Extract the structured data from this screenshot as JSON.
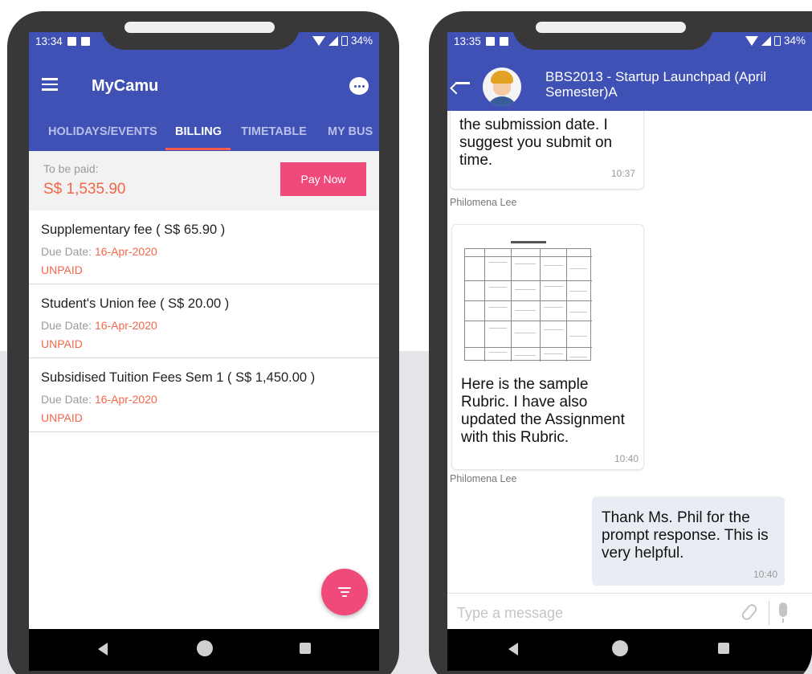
{
  "left_phone": {
    "status": {
      "time": "13:34",
      "battery": "34%"
    },
    "app_title": "MyCamu",
    "tabs": [
      "HOLIDAYS/EVENTS",
      "BILLING",
      "TIMETABLE",
      "MY BUS"
    ],
    "active_tab": "BILLING",
    "to_be_paid": {
      "label": "To be paid:",
      "amount": "S$ 1,535.90",
      "button": "Pay Now"
    },
    "fees": [
      {
        "title": "Supplementary fee ( S$ 65.90 )",
        "due_label": "Due Date: ",
        "due_date": "16-Apr-2020",
        "status": "UNPAID"
      },
      {
        "title": "Student's Union fee ( S$ 20.00 )",
        "due_label": "Due Date: ",
        "due_date": "16-Apr-2020",
        "status": "UNPAID"
      },
      {
        "title": "Subsidised Tuition Fees Sem 1 ( S$ 1,450.00 )",
        "due_label": "Due Date: ",
        "due_date": "16-Apr-2020",
        "status": "UNPAID"
      }
    ]
  },
  "right_phone": {
    "status": {
      "time": "13:35",
      "battery": "34%"
    },
    "chat_title": "BBS2013 - Startup Launchpad (April Semester)A",
    "messages": [
      {
        "lines": [
          "the submission date. I",
          "suggest you submit on",
          "time."
        ],
        "time": "10:37",
        "sender": "Philomena Lee"
      },
      {
        "lines": [
          "Here is the sample",
          "Rubric. I have also",
          "updated the Assignment",
          "with this Rubric."
        ],
        "time": "10:40",
        "sender": "Philomena Lee",
        "attachment": "rubric-image"
      },
      {
        "lines": [
          "Thank Ms. Phil for the",
          "prompt response. This is",
          "very helpful."
        ],
        "time": "10:40"
      }
    ],
    "input_placeholder": "Type a message"
  },
  "colors": {
    "primary": "#3f51b5",
    "accent": "#f04a7a",
    "unpaid": "#f4664a",
    "tab_indicator": "#ff5a4c"
  }
}
